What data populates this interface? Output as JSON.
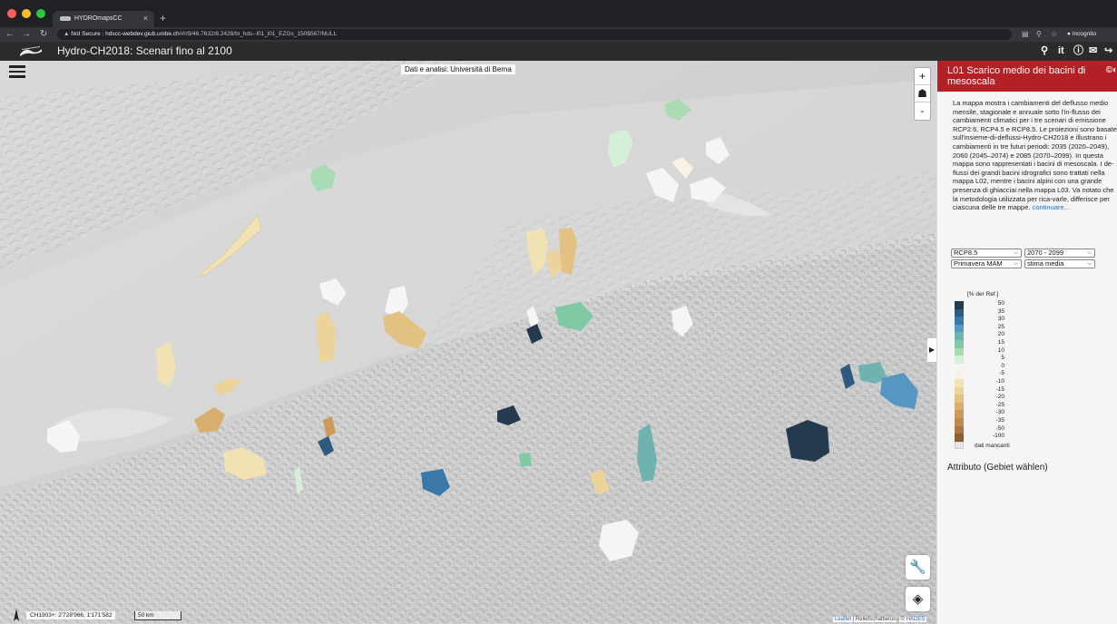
{
  "browser": {
    "tab_title": "HYDROmapsCC",
    "tab_close": "×",
    "new_tab": "+",
    "security_label": "Not Secure",
    "url_host": "hdscc-webdev.giub.unibe.ch",
    "url_path": "/#!/9/46.7632/8.2428/bi_hds--l01_l01_EZGs_150$567/NULL",
    "profile_label": "Incognito"
  },
  "app": {
    "title": "Hydro-CH2018: Scenari fino al 2100",
    "header_icons": [
      "search-icon",
      "language-it",
      "info-icon",
      "mail-icon",
      "share-icon"
    ],
    "language_label": "it"
  },
  "map": {
    "attribution_top": "Dati e analisi: Università di Berna",
    "zoom_in": "+",
    "zoom_out": "-",
    "coordinates": "CH1903+: 2'728'966, 1'171'582",
    "scale_label": "50 km",
    "attribution_bottom_prefix": "Leaflet",
    "attribution_bottom_mid": " | Reliefschattierung ©",
    "attribution_bottom_suffix": "HADES"
  },
  "panel": {
    "title": "L01 Scarico medio dei bacini di mesoscala",
    "description": "La mappa mostra i cambiamenti del deflusso medio mensile, stagionale e annuale sotto l'in-flusso dei cambiamenti climatici per i tre scenari di emissione RCP2.6, RCP4.5 e RCP8.5. Le proiezioni sono basate sull'insieme-di-deflussi-Hydro-CH2018 e illustrano i cambiamenti in tre futuri periodi: 2035 (2020–2049), 2060 (2045–2074) e 2085 (2070–2099). In questa mappa sono rappresentati i bacini di mesoscala. I de-flussi dei grandi bacini idrografici sono trattati nella mappa L02, mentre i bacini alpini con una grande presenza di ghiacciai nella mappa L03. Va notato che la metodologia utilizzata per rica-varle, differisce per ciascuna delle tre mappe.",
    "more_link": "continuare...",
    "selects": {
      "scenario": "RCP8.5",
      "period": "2070 - 2099",
      "season": "Primavera MAM",
      "estimate": "stima media"
    },
    "legend": {
      "title": "[% der Ref.]",
      "labels": [
        "50",
        "35",
        "30",
        "25",
        "20",
        "15",
        "10",
        "5",
        "0",
        "-5",
        "-10",
        "-15",
        "-20",
        "-25",
        "-30",
        "-35",
        "-50",
        "-100"
      ],
      "colors": [
        "#243a4f",
        "#2f5a80",
        "#3b78aa",
        "#5596c3",
        "#6fb3b0",
        "#7fcaa4",
        "#a9dcb5",
        "#d6efd9",
        "#f5f5f5",
        "#f7f2e4",
        "#f1e2b3",
        "#ecd39a",
        "#e3c183",
        "#d9ad6e",
        "#cd9a5c",
        "#c08a50",
        "#ab7844",
        "#8a5e35"
      ],
      "missing_label": "dati mancanti"
    },
    "attribute_title": "Attributo (Gebiet wählen)"
  }
}
